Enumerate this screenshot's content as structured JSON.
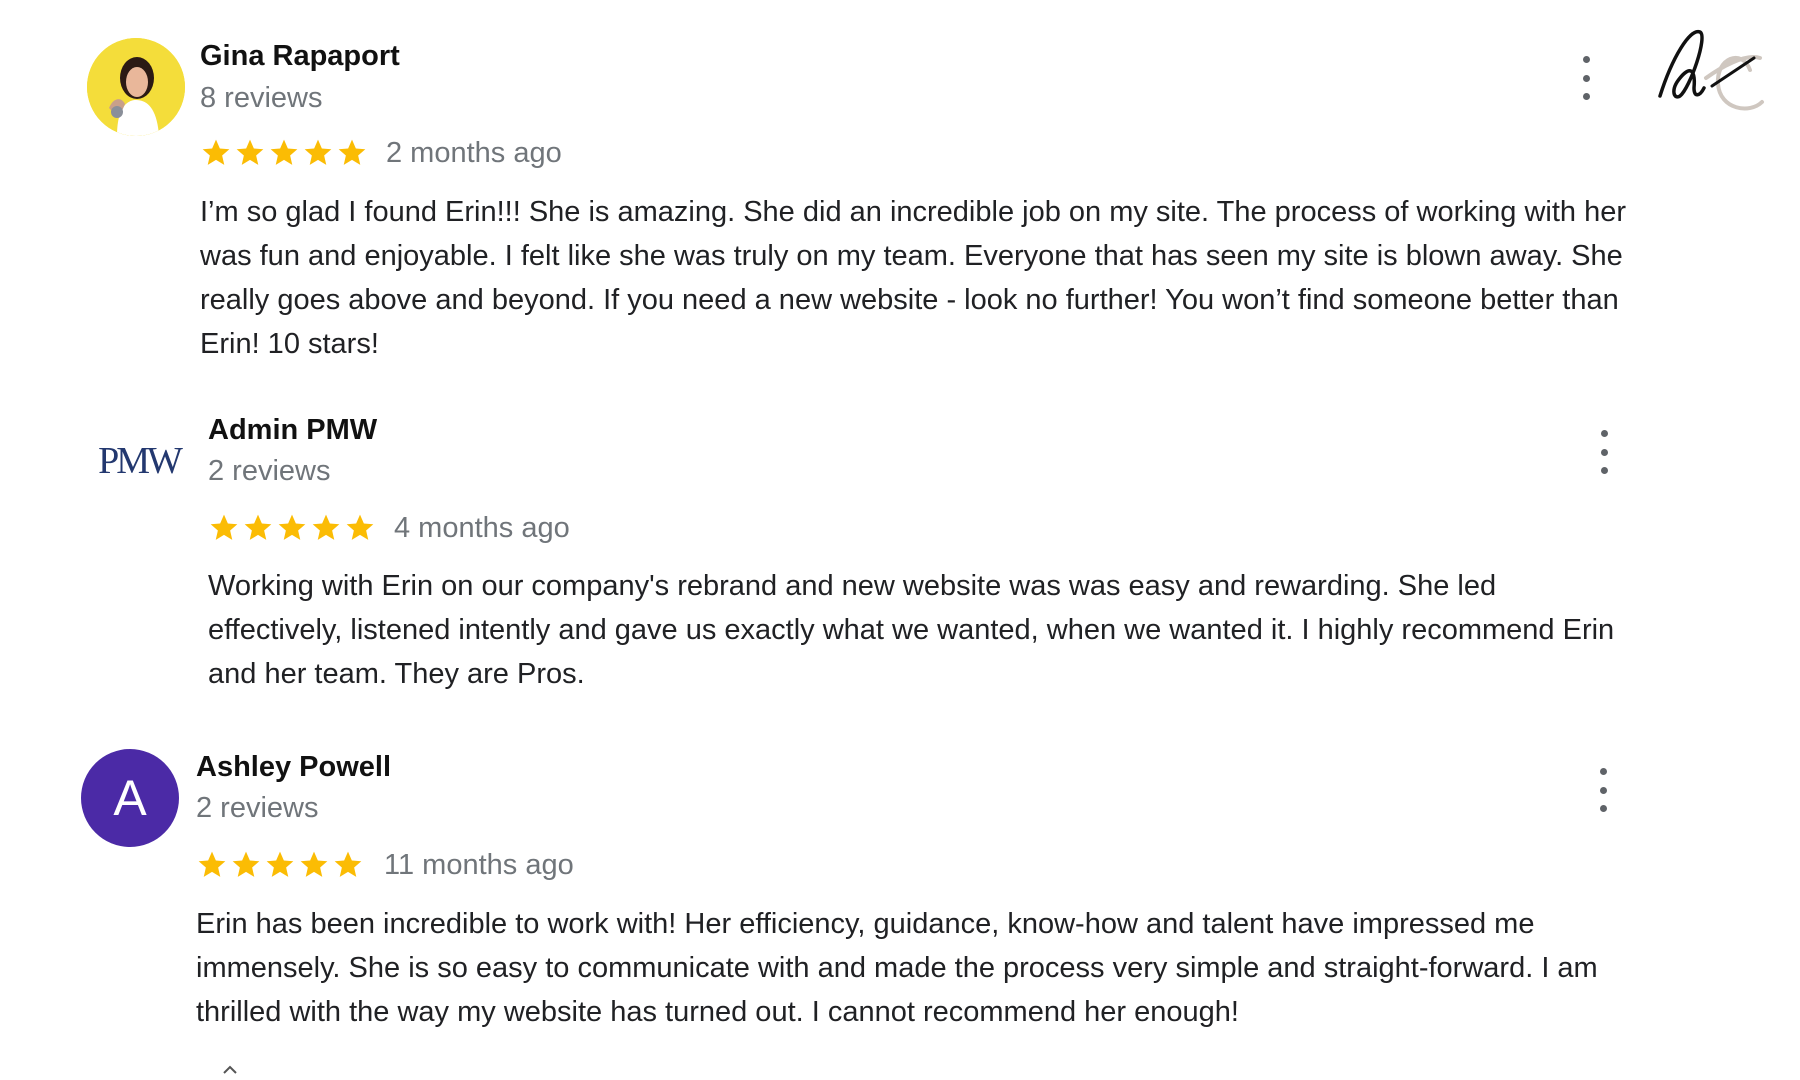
{
  "brand": {
    "logo_icon": "ae-signature-logo"
  },
  "colors": {
    "star": "#fbbc04",
    "muted": "#70757a",
    "avatar_letter_bg": "#4b2aa6"
  },
  "reviews": [
    {
      "name": "Gina Rapaport",
      "review_count": "8 reviews",
      "rating": 5,
      "date": "2 months ago",
      "text": "I’m so glad I found Erin!!! She is amazing. She did an incredible job on my site. The process of working with her was fun and enjoyable. I felt like she was truly on my team. Everyone that has seen my site is blown away. She really goes above and beyond. If you need a new website - look no further! You won’t find someone better than Erin! 10 stars!",
      "avatar": {
        "type": "photo",
        "icon": "person-photo-avatar"
      }
    },
    {
      "name": "Admin PMW",
      "review_count": "2 reviews",
      "rating": 5,
      "date": "4 months ago",
      "text": "Working with Erin on our company's rebrand and new website was was easy and rewarding. She led effectively, listened intently and gave us exactly what we wanted, when we wanted it. I highly recommend Erin and her team. They are Pros.",
      "avatar": {
        "type": "logo",
        "text": "PMW"
      }
    },
    {
      "name": "Ashley Powell",
      "review_count": "2 reviews",
      "rating": 5,
      "date": "11 months ago",
      "text": "Erin has been incredible to work with!  Her efficiency, guidance, know-how and talent have impressed me immensely. She is so easy to communicate with and made the process very simple and straight-forward. I am thrilled with the way my website has turned out.  I cannot recommend her enough!",
      "avatar": {
        "type": "letter",
        "text": "A"
      }
    }
  ],
  "menu_icon": "more-vert-icon",
  "star_icon": "star-icon"
}
